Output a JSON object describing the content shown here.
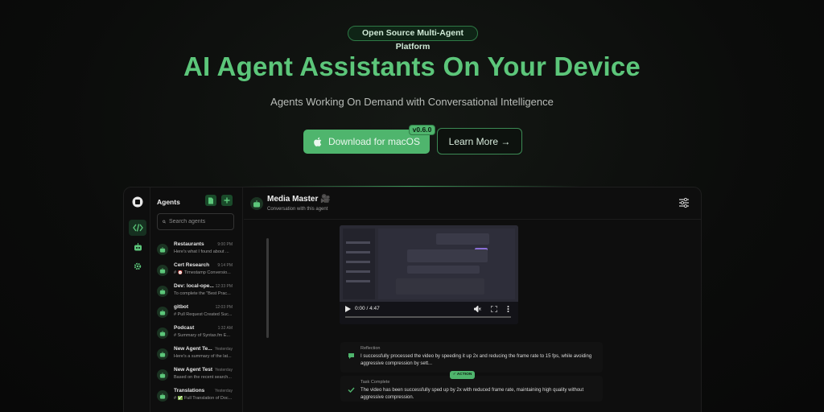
{
  "hero": {
    "badge": "Open Source Multi-Agent Platform",
    "title": "AI Agent Assistants On Your Device",
    "subtitle": "Agents Working On Demand with Conversational Intelligence",
    "download_label": "Download for macOS",
    "version": "v0.6.0",
    "learn_more_label": "Learn More →"
  },
  "app": {
    "sidebar": {
      "title": "Agents",
      "search_placeholder": "Search agents",
      "agents": [
        {
          "name": "Restaurants",
          "time": "9:00 PM",
          "preview": "Here's what I found about ..."
        },
        {
          "name": "Cert Research",
          "time": "9:14 PM",
          "preview": "# ⏰ Timestamp Conversio..."
        },
        {
          "name": "Dev: local-ope...",
          "time": "12:33 PM",
          "preview": "To complete the \"Best Prac..."
        },
        {
          "name": "gitbot",
          "time": "12:03 PM",
          "preview": "# Pull Request Created Suc..."
        },
        {
          "name": "Podcast",
          "time": "1:32 AM",
          "preview": "# Summary of Syntax.fm E..."
        },
        {
          "name": "New Agent Te...",
          "time": "Yesterday",
          "preview": "Here's a summary of the lat..."
        },
        {
          "name": "New Agent Test",
          "time": "Yesterday",
          "preview": "Based on the recent search..."
        },
        {
          "name": "Translations",
          "time": "Yesterday",
          "preview": "# ✅ Full Translation of Doc..."
        }
      ]
    },
    "chat": {
      "agent_name": "Media Master 🎥",
      "agent_subtitle": "Conversation with this agent",
      "video_time": "0:00 / 4:47",
      "messages": [
        {
          "label": "Reflection",
          "text": "I successfully processed the video by speeding it up 2x and reducing the frame rate to 15 fps, while avoiding aggressive compression by sett..."
        },
        {
          "label": "Task Complete",
          "text": "The video has been successfully sped up by 2x with reduced frame rate, maintaining high quality without aggressive compression."
        }
      ],
      "action_badge": "✓ ACTION"
    }
  },
  "colors": {
    "accent": "#5cc67a",
    "button": "#4fb56d",
    "background": "#0b0c0b"
  }
}
